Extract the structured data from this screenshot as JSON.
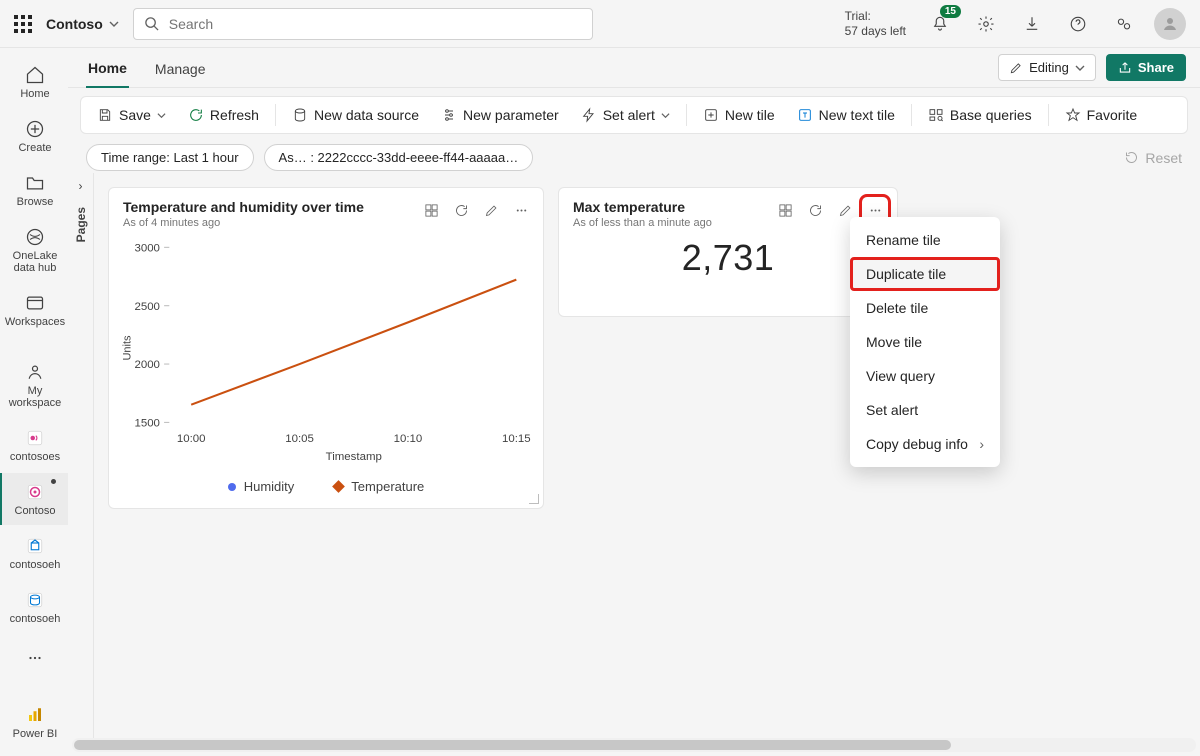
{
  "topbar": {
    "workspace": "Contoso",
    "search_placeholder": "Search",
    "trial_label": "Trial:",
    "trial_value": "57 days left",
    "notifications_badge": "15"
  },
  "rail": {
    "items": [
      {
        "label": "Home",
        "icon": "home-icon"
      },
      {
        "label": "Create",
        "icon": "plus-circle-icon"
      },
      {
        "label": "Browse",
        "icon": "folder-icon"
      },
      {
        "label": "OneLake data hub",
        "icon": "onelake-icon"
      },
      {
        "label": "Workspaces",
        "icon": "workspaces-icon"
      },
      {
        "label": "My workspace",
        "icon": "myws-icon"
      },
      {
        "label": "contosoes",
        "icon": "ws-es-icon"
      },
      {
        "label": "Contoso",
        "icon": "ws-co-icon",
        "active": true
      },
      {
        "label": "contosoeh",
        "icon": "ws-eh1-icon"
      },
      {
        "label": "contosoeh",
        "icon": "ws-eh2-icon"
      }
    ],
    "bottom_label": "Power BI"
  },
  "tabs": {
    "home": "Home",
    "manage": "Manage",
    "edit_label": "Editing",
    "share_label": "Share"
  },
  "ribbon": {
    "save": "Save",
    "refresh": "Refresh",
    "new_datasource": "New data source",
    "new_parameter": "New parameter",
    "set_alert": "Set alert",
    "new_tile": "New tile",
    "new_text_tile": "New text tile",
    "base_queries": "Base queries",
    "favorite": "Favorite"
  },
  "params": {
    "time_range": "Time range: Last 1 hour",
    "as_label": "As… : 2222cccc-33dd-eeee-ff44-aaaaa…",
    "reset": "Reset"
  },
  "pages_label": "Pages",
  "tile_chart": {
    "title": "Temperature and humidity over time",
    "subtitle": "As of 4 minutes ago",
    "x_label": "Timestamp",
    "y_label": "Units",
    "legend_a": "Humidity",
    "legend_b": "Temperature"
  },
  "tile_kpi": {
    "title": "Max temperature",
    "subtitle": "As of less than a minute ago",
    "value": "2,731"
  },
  "ctx": {
    "rename": "Rename tile",
    "duplicate": "Duplicate tile",
    "delete": "Delete tile",
    "move": "Move tile",
    "view_query": "View query",
    "set_alert": "Set alert",
    "copy_debug": "Copy debug info"
  },
  "chart_data": {
    "type": "line",
    "xlabel": "Timestamp",
    "ylabel": "Units",
    "ylim": [
      1500,
      3000
    ],
    "categories": [
      "10:00",
      "10:05",
      "10:10",
      "10:15"
    ],
    "series": [
      {
        "name": "Humidity",
        "color": "#4f6bed",
        "values": [
          1650,
          2000,
          2360,
          2730
        ]
      },
      {
        "name": "Temperature",
        "color": "#ca5010",
        "values": [
          1650,
          2000,
          2360,
          2730
        ]
      }
    ],
    "yticks": [
      1500,
      2000,
      2500,
      3000
    ]
  }
}
